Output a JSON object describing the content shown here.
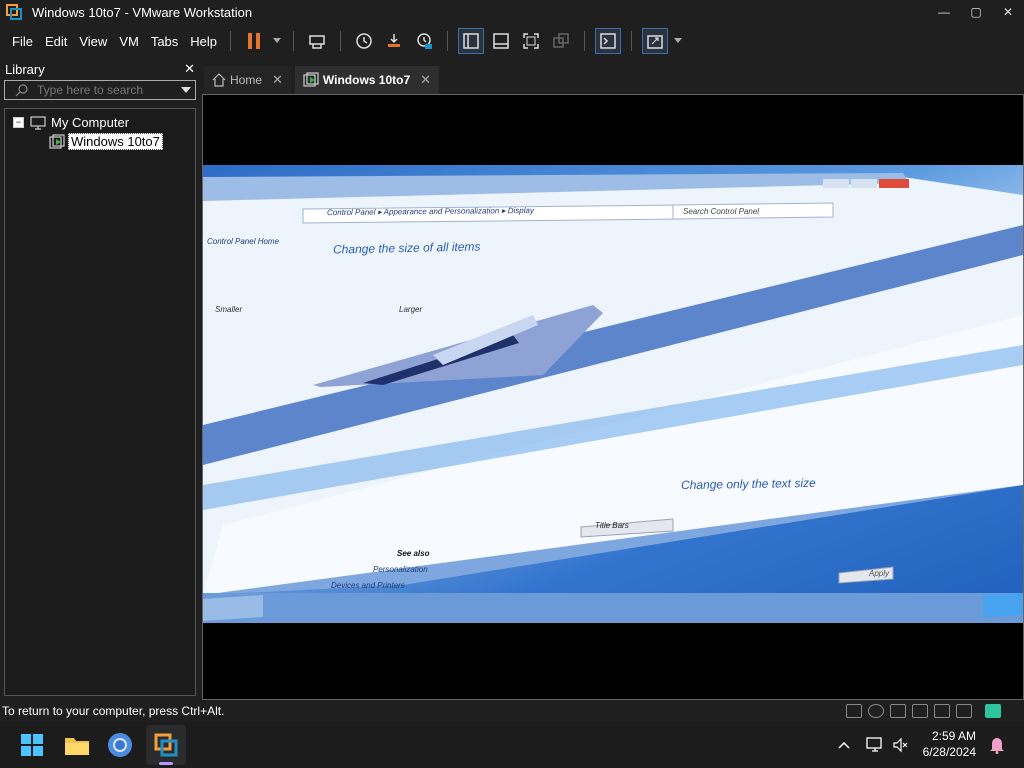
{
  "window": {
    "title": "Windows 10to7 - VMware Workstation",
    "controls": [
      "—",
      "▢",
      "✕"
    ]
  },
  "menu": [
    "File",
    "Edit",
    "View",
    "VM",
    "Tabs",
    "Help"
  ],
  "library": {
    "title": "Library",
    "close": "✕",
    "search_placeholder": "Type here to search",
    "tree": {
      "root": "My Computer",
      "vm": "Windows 10to7",
      "expander": "−"
    }
  },
  "tabs": [
    {
      "label": "Home",
      "close": "✕"
    },
    {
      "label": "Windows 10to7",
      "close": "✕"
    }
  ],
  "guest": {
    "heading1": "Change the size of all items",
    "heading2": "Change only the text size",
    "breadcrumb": "Control Panel ▸ Appearance and Personalization ▸ Display",
    "search": "Search Control Panel",
    "sidebar_link": "Control Panel Home",
    "smaller": "Smaller",
    "larger": "Larger",
    "see_also": "See also",
    "personalization": "Personalization",
    "devices": "Devices and Printers",
    "title_bars": "Title Bars",
    "apply": "Apply"
  },
  "status": {
    "message": "To return to your computer, press Ctrl+Alt."
  },
  "taskbar": {
    "time": "2:59 AM",
    "date": "6/28/2024"
  },
  "colors": {
    "accent": "#3b6ea5",
    "pause": "#e8732c",
    "folder": "#f2c14e",
    "vmware": "#1e90c8"
  }
}
